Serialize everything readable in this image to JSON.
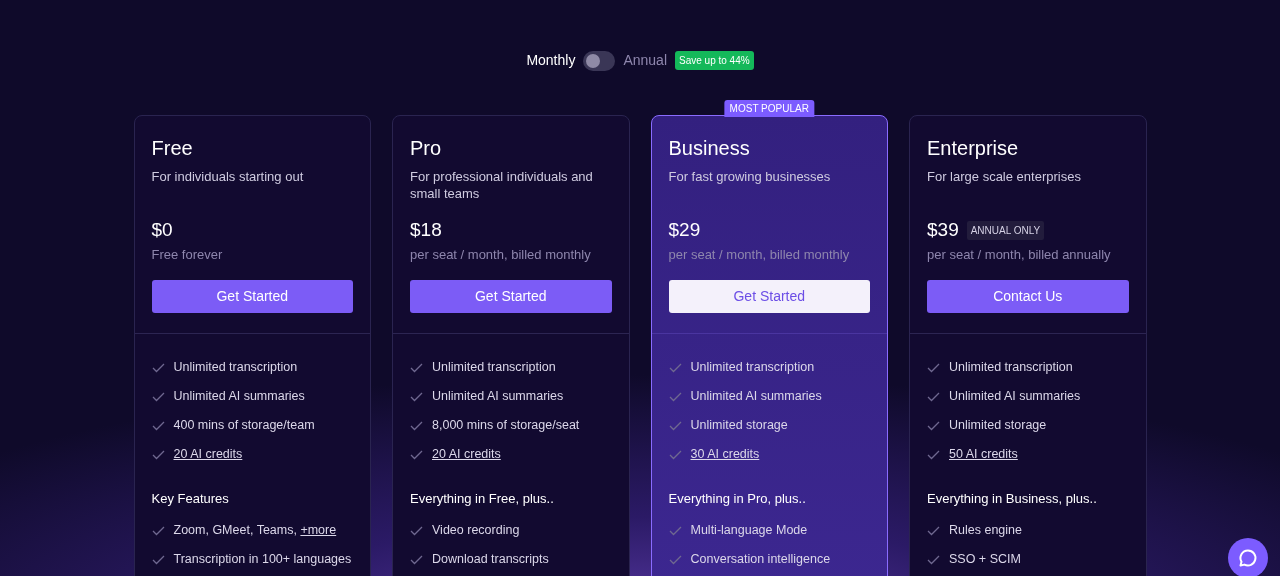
{
  "billing": {
    "options": [
      {
        "label": "Monthly",
        "selected": true
      },
      {
        "label": "Annual",
        "selected": false
      }
    ],
    "toggle_on": false,
    "badge": "Save up to 44%"
  },
  "plans": [
    {
      "name": "Free",
      "description": "For individuals starting out",
      "price": "$0",
      "price_note": "Free forever",
      "featured": false,
      "button": {
        "label": "Get Started",
        "kind": "primary"
      },
      "features": [
        {
          "text": "Unlimited transcription"
        },
        {
          "text": "Unlimited AI summaries"
        },
        {
          "text": "400 mins of storage/team"
        },
        {
          "link": "20 AI credits"
        }
      ],
      "section_title": "Key Features",
      "section_features": [
        {
          "text": "Zoom, GMeet, Teams,",
          "link": "+more"
        },
        {
          "text": "Transcription in 100+ languages"
        }
      ]
    },
    {
      "name": "Pro",
      "description": "For professional individuals and small teams",
      "price": "$18",
      "price_note": "per seat / month, billed monthly",
      "featured": false,
      "button": {
        "label": "Get Started",
        "kind": "primary"
      },
      "features": [
        {
          "text": "Unlimited transcription"
        },
        {
          "text": "Unlimited AI summaries"
        },
        {
          "text": "8,000 mins of storage/seat"
        },
        {
          "link": "20 AI credits"
        }
      ],
      "section_title": "Everything in Free, plus..",
      "section_features": [
        {
          "text": "Video recording"
        },
        {
          "text": "Download transcripts"
        }
      ]
    },
    {
      "name": "Business",
      "description": "For fast growing businesses",
      "price": "$29",
      "price_note": "per seat / month, billed monthly",
      "featured": true,
      "ribbon": "MOST POPULAR",
      "button": {
        "label": "Get Started",
        "kind": "light"
      },
      "features": [
        {
          "text": "Unlimited transcription"
        },
        {
          "text": "Unlimited AI summaries"
        },
        {
          "text": "Unlimited storage"
        },
        {
          "link": "30 AI credits"
        }
      ],
      "section_title": "Everything in Pro, plus..",
      "section_features": [
        {
          "text": "Multi-language Mode"
        },
        {
          "text": "Conversation intelligence"
        }
      ]
    },
    {
      "name": "Enterprise",
      "description": "For large scale enterprises",
      "price": "$39",
      "price_badge": "ANNUAL ONLY",
      "price_note": "per seat / month, billed annually",
      "featured": false,
      "button": {
        "label": "Contact Us",
        "kind": "primary"
      },
      "features": [
        {
          "text": "Unlimited transcription"
        },
        {
          "text": "Unlimited AI summaries"
        },
        {
          "text": "Unlimited storage"
        },
        {
          "link": "50 AI credits"
        }
      ],
      "section_title": "Everything in Business, plus..",
      "section_features": [
        {
          "text": "Rules engine"
        },
        {
          "text": "SSO + SCIM"
        }
      ]
    }
  ]
}
